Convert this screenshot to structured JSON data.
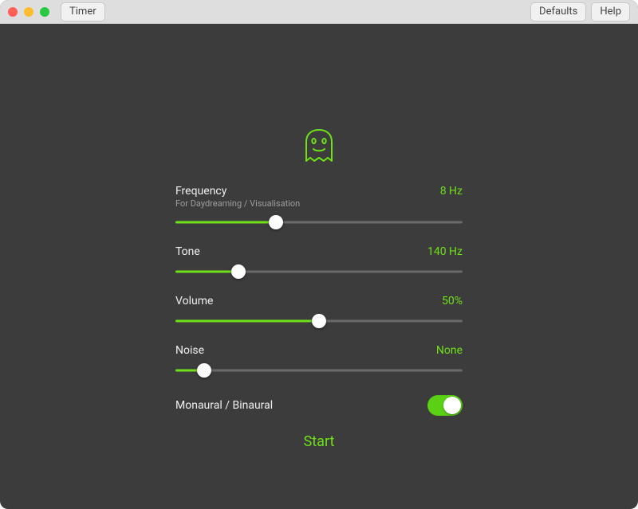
{
  "accent": "#6fe118",
  "titlebar": {
    "timer_label": "Timer",
    "defaults_label": "Defaults",
    "help_label": "Help"
  },
  "controls": {
    "frequency": {
      "label": "Frequency",
      "sublabel": "For Daydreaming / Visualisation",
      "value": "8 Hz",
      "percent": 35
    },
    "tone": {
      "label": "Tone",
      "value": "140 Hz",
      "percent": 22
    },
    "volume": {
      "label": "Volume",
      "value": "50%",
      "percent": 50
    },
    "noise": {
      "label": "Noise",
      "value": "None",
      "percent": 10
    },
    "binaural": {
      "label": "Monaural / Binaural",
      "on": true
    }
  },
  "start_label": "Start"
}
